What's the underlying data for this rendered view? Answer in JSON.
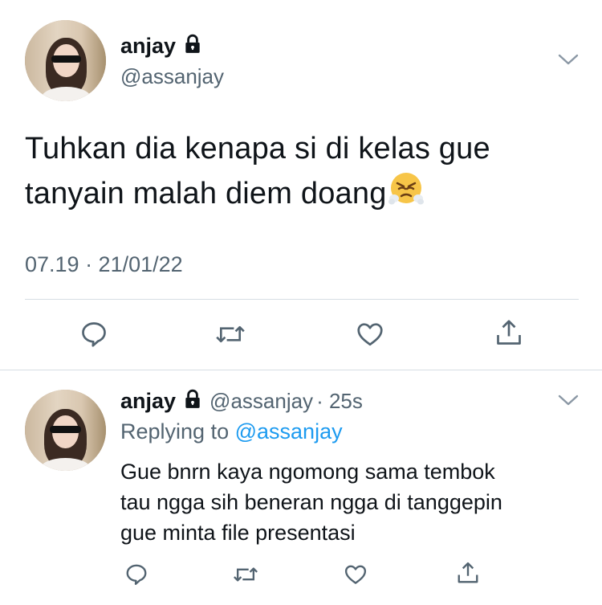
{
  "tweet": {
    "display_name": "anjay",
    "handle": "@assanjay",
    "text_line1": "Tuhkan dia kenapa si di kelas gue",
    "text_line2": "tanyain malah diem doang",
    "timestamp": "07.19 · 21/01/22"
  },
  "reply": {
    "display_name": "anjay",
    "handle": "@assanjay",
    "time": "· 25s",
    "replying_prefix": "Replying to",
    "replying_to": "@assanjay",
    "text_line1": "Gue bnrn kaya ngomong sama tembok",
    "text_line2": "tau ngga sih beneran ngga di tanggepin",
    "text_line3": "gue minta file presentasi"
  },
  "icons": [
    "lock-icon",
    "chevron-down-icon",
    "reply-icon",
    "retweet-icon",
    "like-icon",
    "share-icon",
    "steam-face-emoji"
  ],
  "colors": {
    "text": "#0f1419",
    "secondary": "#536471",
    "link": "#1d9bf0",
    "divider": "#d6dde3"
  }
}
